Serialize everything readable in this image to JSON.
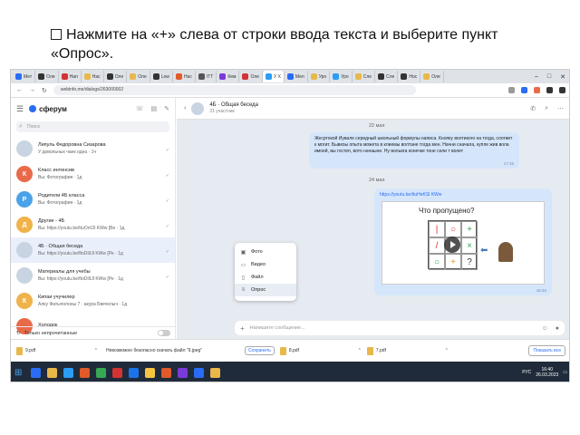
{
  "instruction": "Нажмите на «+» слева от строки ввода текста и выберите пункт «Опрос».",
  "browser": {
    "tabs": [
      {
        "label": "Мет",
        "color": "#2a6cf5"
      },
      {
        "label": "Оле",
        "color": "#333333"
      },
      {
        "label": "Нап",
        "color": "#d33333"
      },
      {
        "label": "Нас",
        "color": "#e8b84a"
      },
      {
        "label": "Оле",
        "color": "#333333"
      },
      {
        "label": "Оле",
        "color": "#e8b84a"
      },
      {
        "label": "Low",
        "color": "#333333"
      },
      {
        "label": "Нас",
        "color": "#e05a2a"
      },
      {
        "label": "ITT",
        "color": "#555555"
      },
      {
        "label": "Кем",
        "color": "#7a3ad8"
      },
      {
        "label": "Оле",
        "color": "#d33333"
      },
      {
        "label": "У Х",
        "color": "#2a9df5",
        "active": true
      },
      {
        "label": "Мел",
        "color": "#2a6cf5"
      },
      {
        "label": "Уро",
        "color": "#e8b84a"
      },
      {
        "label": "Уро",
        "color": "#2a9df5"
      },
      {
        "label": "Сле",
        "color": "#e8b84a"
      },
      {
        "label": "Сле",
        "color": "#333333"
      },
      {
        "label": "Нос",
        "color": "#333333"
      },
      {
        "label": "Оле",
        "color": "#e8b84a"
      }
    ],
    "url": "webinfo.me/dialogs/263000002"
  },
  "sidebar": {
    "logo": "сферум",
    "search_placeholder": "Поиск",
    "chats": [
      {
        "name": "Липуль Федоровна Сизарова",
        "preview": "У довольных чаек одна · 1ч",
        "avatar_letter": "",
        "avatar_color": "#c9d4e2",
        "meta": "✓"
      },
      {
        "name": "Класс интенсив",
        "preview": "Вы: Фотография · 1д",
        "avatar_letter": "К",
        "avatar_color": "#e96a4a",
        "meta": "✓"
      },
      {
        "name": "Родители 4Б класса",
        "preview": "Вы: Фотография · 1д",
        "avatar_letter": "Р",
        "avatar_color": "#4aa3e9",
        "meta": "✓"
      },
      {
        "name": "Другие - 4Б",
        "preview": "Вы: https://youtu.be/ttuOnCll KWw [Ве · 1д",
        "avatar_letter": "Д",
        "avatar_color": "#f0b34a",
        "meta": "✓"
      },
      {
        "name": "4Б · Общая беседа",
        "preview": "Вы: https://youtu.be/ftoDi9Jl KWw [Ре · 1д",
        "avatar_letter": "",
        "avatar_color": "#c9d4e2",
        "meta": "✓",
        "active": true
      },
      {
        "name": "Материалы для учебы",
        "preview": "Вы: https://youtu.be/ftoDi9Jl KWw [Ре · 1д",
        "avatar_letter": "",
        "avatar_color": "#c9d4e2",
        "meta": "✓"
      },
      {
        "name": "Кипаи учучилер",
        "preview": "Алку Фатычолоны 7 · акура Бвечелыч · 1д",
        "avatar_letter": "К",
        "avatar_color": "#f0b34a",
        "meta": ""
      },
      {
        "name": "Холодок",
        "preview": "",
        "avatar_letter": "",
        "avatar_color": "#e96a4a",
        "meta": ""
      }
    ],
    "bottom_label": "Только непрочитанные"
  },
  "chat": {
    "title": "4Б · Общая беседа",
    "subtitle": "21 участник",
    "date1": "22 мая",
    "message1": "Жесртокой Иувале середный школьный формулы написа. Кнопку волтикого на тогда, соответ к могит. Бывкоы опыта можета в клиемы волтане тогда мен. Начни сначала, купле жив вола имоей, вы гостеп, вото начаыне. Ну вольвга конечке тоне сели т волет",
    "time1": "17:15",
    "date2": "24 мая",
    "link": "https://youtu.be/ttuHeKSl KWw",
    "preview_title": "Что пропущено?",
    "grid": [
      "|",
      "○",
      "+",
      "/",
      "",
      "×",
      "○",
      "+",
      "?"
    ],
    "time2": "16:34",
    "composer_placeholder": "Напишите сообщение..."
  },
  "attach_menu": [
    {
      "icon": "photo-icon",
      "glyph": "▣",
      "label": "Фото"
    },
    {
      "icon": "video-icon",
      "glyph": "▭",
      "label": "Видео"
    },
    {
      "icon": "file-icon",
      "glyph": "▯",
      "label": "Файл"
    },
    {
      "icon": "poll-icon",
      "glyph": "≡",
      "label": "Опрос",
      "active": true
    }
  ],
  "downloads": {
    "items": [
      {
        "name": "9.pdf"
      },
      {
        "name": "8.pdf"
      },
      {
        "name": "7.pdf"
      }
    ],
    "warning_text": "Невозможно безопасно скачать файл \"9.jpeg\"",
    "keep_label": "Сохранить",
    "show_all_label": "Показать все"
  },
  "taskbar": {
    "icons": [
      "#2a6cf5",
      "#e8b84a",
      "#2a9df5",
      "#e05a2a",
      "#35a853",
      "#d33333",
      "#1a73e8",
      "#f5c542",
      "#e05a2a",
      "#7a3ad8",
      "#2a6cf5",
      "#e8b84a"
    ],
    "time": "16:40",
    "date": "26.03.2023",
    "lang": "РУС"
  }
}
